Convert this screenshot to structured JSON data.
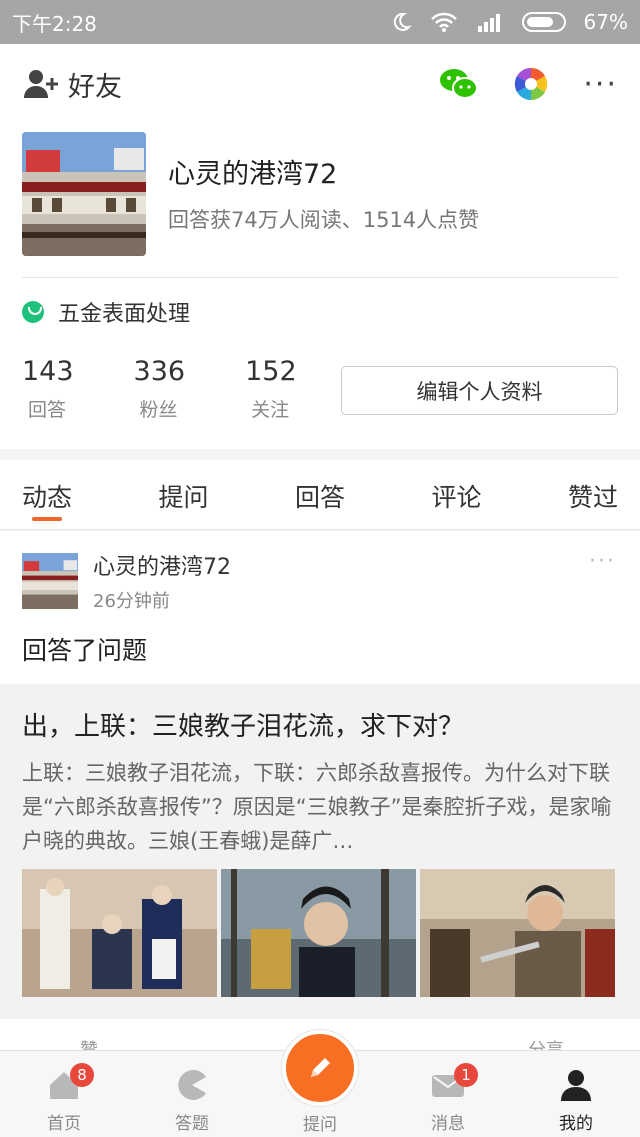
{
  "statusbar": {
    "time": "下午2:28",
    "battery": "67%"
  },
  "topbar": {
    "add_friend_label": "好友"
  },
  "profile": {
    "username": "心灵的港湾72",
    "stats_line": "回答获74万人阅读、1514人点赞",
    "topic": "五金表面处理",
    "counts": [
      {
        "num": "143",
        "label": "回答"
      },
      {
        "num": "336",
        "label": "粉丝"
      },
      {
        "num": "152",
        "label": "关注"
      }
    ],
    "edit_button": "编辑个人资料"
  },
  "tabs": [
    "动态",
    "提问",
    "回答",
    "评论",
    "赞过"
  ],
  "feed": {
    "name": "心灵的港湾72",
    "time": "26分钟前",
    "action": "回答了问题",
    "card": {
      "title": "出，上联：三娘教子泪花流，求下对？",
      "excerpt": "上联：三娘教子泪花流，下联：六郎杀敌喜报传。为什么对下联是“六郎杀敌喜报传”？原因是“三娘教子”是秦腔折子戏，是家喻户晓的典故。三娘(王春蛾)是薛广…"
    },
    "actions": {
      "like": "赞",
      "share": "分享"
    }
  },
  "bottomnav": [
    {
      "label": "首页",
      "badge": "8"
    },
    {
      "label": "答题",
      "badge": ""
    },
    {
      "label": "提问",
      "badge": ""
    },
    {
      "label": "消息",
      "badge": "1"
    },
    {
      "label": "我的",
      "badge": ""
    }
  ],
  "colors": {
    "accent": "#f0662a",
    "compose": "#f86f24",
    "badge": "#e8483c",
    "topic_dot": "#1fc07a"
  }
}
